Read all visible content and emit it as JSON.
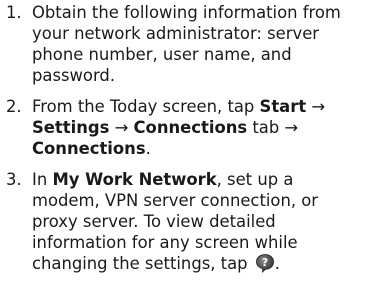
{
  "steps": [
    {
      "number": "1.",
      "text": "Obtain the following information from your network administrator: server phone number, user name, and password."
    },
    {
      "number": "2.",
      "prefix": "From the Today screen, tap ",
      "start": "Start",
      "arrow1": " → ",
      "settings": "Settings",
      "arrow2": " → ",
      "connections_tab": "Connections",
      "tab_word": " tab → ",
      "connections": "Connections",
      "end": "."
    },
    {
      "number": "3.",
      "prefix": "In ",
      "my_work_network": "My Work Network",
      "middle": ", set up a modem, VPN server connection, or proxy server. To view detailed information for any screen while changing the settings, tap ",
      "icon": "help-icon",
      "end": "."
    }
  ]
}
